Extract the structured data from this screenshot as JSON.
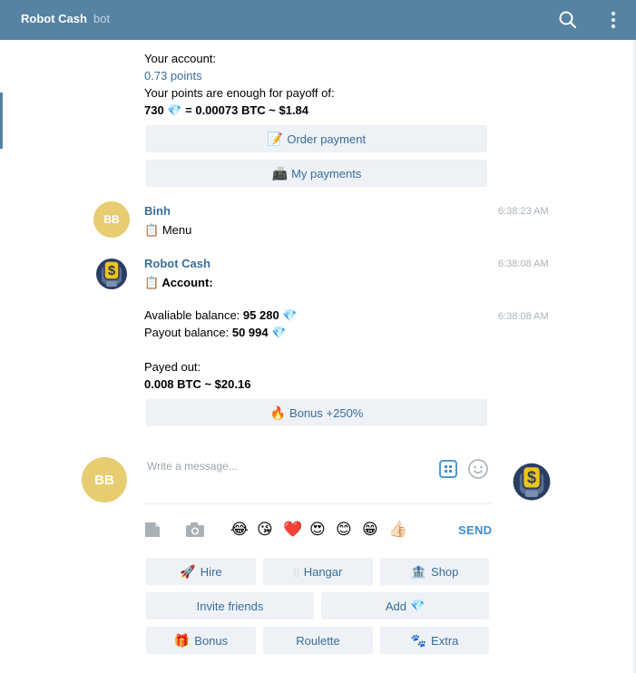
{
  "header": {
    "title": "Robot Cash",
    "subtitle": "bot"
  },
  "msg_account": {
    "line1": "Your account:",
    "points": "0.73 points",
    "line3": "Your points are enough for payoff of:",
    "amount_a": "730",
    "amount_b": "= 0.00073 BTC ~ $1.84",
    "order_btn": "Order payment",
    "order_emoji": "📝",
    "payments_btn": "My payments",
    "payments_emoji": "📠"
  },
  "msg_binh": {
    "avatar": "BB",
    "name": "Binh",
    "time": "6:38:23 AM",
    "emoji": "📋",
    "text": "Menu"
  },
  "msg_bot": {
    "name": "Robot Cash",
    "time1": "6:38:08 AM",
    "time2": "6:38:08 AM",
    "emoji": "📋",
    "heading": "Account:",
    "avail_label": "Avaliable balance:",
    "avail_value": "95 280",
    "payout_label": "Payout balance:",
    "payout_value": "50 994",
    "payed_label": "Payed out:",
    "payed_value": "0.008 BTC ~ $20.16",
    "bonus_btn": "Bonus +250%",
    "bonus_emoji": "🔥"
  },
  "composer": {
    "avatar": "BB",
    "placeholder": "Write a message...",
    "send": "SEND",
    "emojis": [
      "😂",
      "😘",
      "❤️",
      "😍",
      "😊",
      "😁",
      "👍🏻"
    ]
  },
  "keyboard": {
    "row1": [
      {
        "emoji": "🚀",
        "label": "Hire"
      },
      {
        "emoji": "▯",
        "label": "Hangar"
      },
      {
        "emoji": "🏦",
        "label": "Shop"
      }
    ],
    "row2": [
      {
        "emoji": "",
        "label": "Invite friends"
      },
      {
        "emoji": "💎",
        "label": "Add"
      }
    ],
    "row3": [
      {
        "emoji": "🎁",
        "label": "Bonus"
      },
      {
        "emoji": "",
        "label": "Roulette"
      },
      {
        "emoji": "🐾",
        "label": "Extra"
      }
    ]
  },
  "icons": {
    "gem": "💎",
    "search": "search-icon",
    "more": "more-vertical-icon",
    "keyboard": "bot-keyboard-icon",
    "smile": "smile-icon",
    "attach": "document-icon",
    "camera": "camera-icon"
  },
  "colors": {
    "header": "#5682a3",
    "link": "#3a6d99",
    "avatar": "#e8cc71",
    "button_bg": "#eef2f6",
    "send": "#3a8fd0"
  }
}
